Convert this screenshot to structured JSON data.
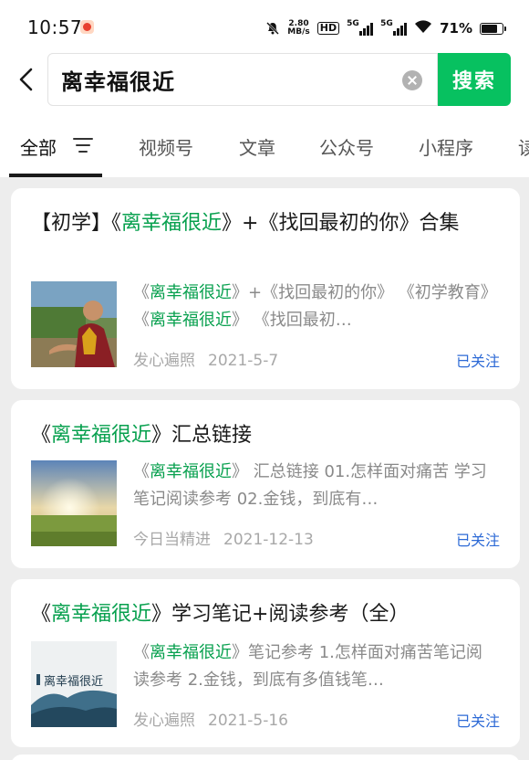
{
  "status_bar": {
    "time": "10:57",
    "speed_value": "2.80",
    "speed_unit": "MB/s",
    "hd_label": "HD",
    "sim1_label": "5G",
    "sim2_label": "5G",
    "battery_percent": "71%",
    "battery_level": 0.71
  },
  "search": {
    "query": "离幸福很近",
    "button_label": "搜索"
  },
  "tabs": [
    "全部",
    "视频号",
    "文章",
    "公众号",
    "小程序",
    "读"
  ],
  "results": [
    {
      "title_parts": [
        "【初学】《",
        "离幸福很近",
        "》+《找回最初的你》合集"
      ],
      "desc_parts": [
        "《",
        "离幸福很近",
        "》+《找回最初的你》 《初学教育》 《",
        "离幸福很近",
        "》 《找回最初…"
      ],
      "source": "发心遍照",
      "date": "2021-5-7",
      "follow_label": "已关注"
    },
    {
      "title_parts": [
        "《",
        "离幸福很近",
        "》汇总链接"
      ],
      "desc_parts": [
        "《",
        "离幸福很近",
        "》 汇总链接 01.怎样面对痛苦 学习笔记阅读参考 02.金钱，到底有…"
      ],
      "source": "今日当精进",
      "date": "2021-12-13",
      "follow_label": "已关注"
    },
    {
      "title_parts": [
        "《",
        "离幸福很近",
        "》学习笔记+阅读参考（全）"
      ],
      "desc_parts": [
        "《",
        "离幸福很近",
        "》笔记参考 1.怎样面对痛苦笔记阅读参考 2.金钱，到底有多值钱笔…"
      ],
      "thumb_text": "离幸福很近",
      "source": "发心遍照",
      "date": "2021-5-16",
      "follow_label": "已关注"
    }
  ],
  "colors": {
    "accent_green": "#07c160",
    "highlight_green": "#07a04e",
    "follow_blue": "#2d6ad6"
  }
}
